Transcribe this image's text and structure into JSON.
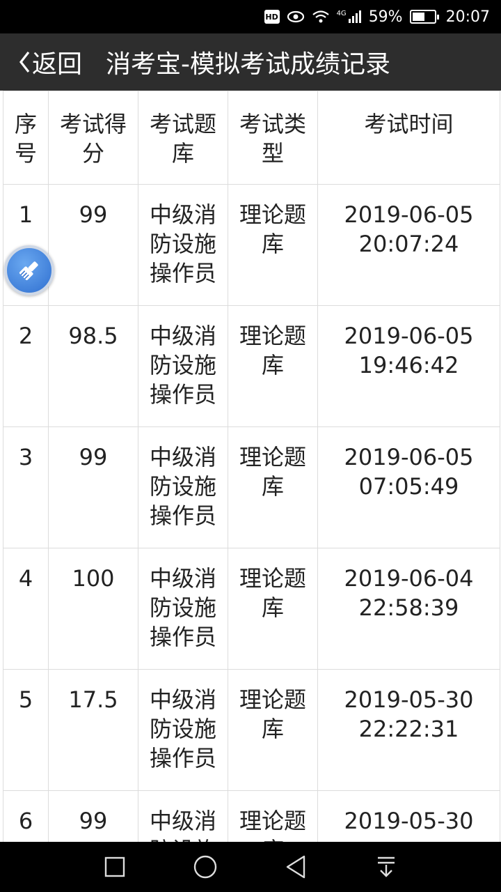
{
  "status_bar": {
    "hd": "HD",
    "network": "4G",
    "battery_percent": "59%",
    "battery_level": 0.59,
    "time": "20:07"
  },
  "title_bar": {
    "back_label": "返回",
    "title": "消考宝-模拟考试成绩记录"
  },
  "table": {
    "headers": [
      "序号",
      "考试得分",
      "考试题库",
      "考试类型",
      "考试时间"
    ],
    "rows": [
      {
        "no": "1",
        "score": "99",
        "bank": "中级消防设施操作员",
        "type": "理论题库",
        "date": "2019-06-05",
        "time": "20:07:24"
      },
      {
        "no": "2",
        "score": "98.5",
        "bank": "中级消防设施操作员",
        "type": "理论题库",
        "date": "2019-06-05",
        "time": "19:46:42"
      },
      {
        "no": "3",
        "score": "99",
        "bank": "中级消防设施操作员",
        "type": "理论题库",
        "date": "2019-06-05",
        "time": "07:05:49"
      },
      {
        "no": "4",
        "score": "100",
        "bank": "中级消防设施操作员",
        "type": "理论题库",
        "date": "2019-06-04",
        "time": "22:58:39"
      },
      {
        "no": "5",
        "score": "17.5",
        "bank": "中级消防设施操作员",
        "type": "理论题库",
        "date": "2019-05-30",
        "time": "22:22:31"
      },
      {
        "no": "6",
        "score": "99",
        "bank": "中级消防设施操作员",
        "type": "理论题库",
        "date": "2019-05-30",
        "time": ""
      }
    ]
  },
  "icons": {
    "back": "chevron-left-icon",
    "float": "brush-icon",
    "nav": [
      "square-icon",
      "circle-icon",
      "triangle-back-icon",
      "pull-down-icon"
    ]
  }
}
